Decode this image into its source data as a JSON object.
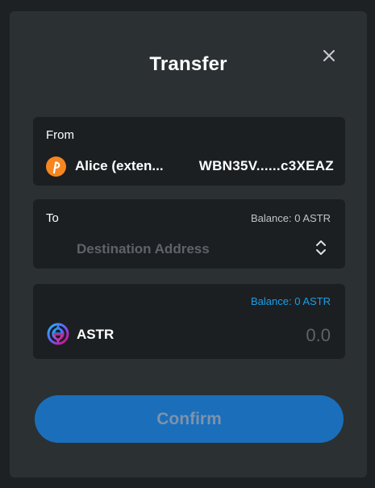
{
  "modal": {
    "title": "Transfer"
  },
  "from": {
    "label": "From",
    "account_name": "Alice (exten...",
    "account_address": "WBN35V......c3XEAZ",
    "account_icon": "polkadot-icon",
    "account_icon_color": "#f6861f"
  },
  "to": {
    "label": "To",
    "balance": "Balance: 0 ASTR",
    "destination_placeholder": "Destination Address",
    "destination_value": ""
  },
  "amount": {
    "balance": "Balance: 0 ASTR",
    "token": "ASTR",
    "token_icon": "astar-icon",
    "amount_placeholder": "0.0",
    "amount_value": ""
  },
  "actions": {
    "confirm_label": "Confirm"
  },
  "colors": {
    "modal_bg": "#2b3033",
    "card_bg": "#1b1f22",
    "accent_blue": "#1b6eba",
    "balance_link": "#1a9fe6",
    "account_orange": "#f6861f"
  }
}
